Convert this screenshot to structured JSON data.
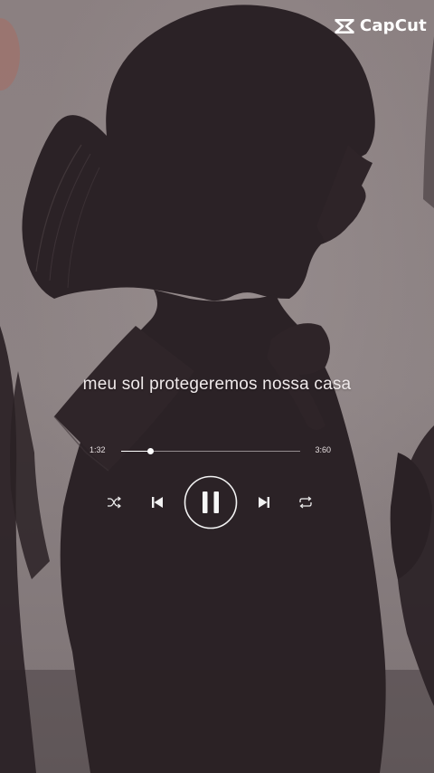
{
  "watermark": {
    "text": "CapCut",
    "icon": "capcut-logo-icon"
  },
  "lyric": {
    "text": "meu sol protegeremos nossa casa"
  },
  "player": {
    "elapsed": "1:32",
    "total": "3:60",
    "progress_fraction": 0.16,
    "state": "playing",
    "controls": [
      "shuffle-icon",
      "previous-icon",
      "pause-icon",
      "next-icon",
      "repeat-icon"
    ]
  },
  "colors": {
    "background": "#8a7f80",
    "silhouette": "#2b2226",
    "text": "#efe9ea"
  }
}
